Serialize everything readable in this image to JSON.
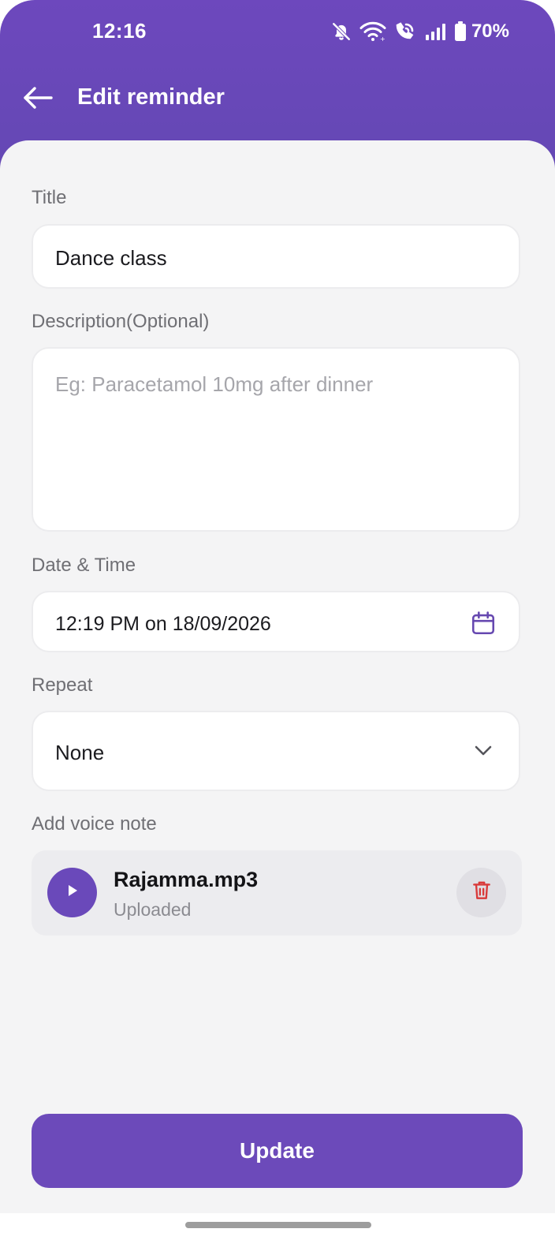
{
  "status_bar": {
    "time": "12:16",
    "battery": "70%",
    "icons": [
      "bell-off-icon",
      "wifi-icon",
      "wifi-calling-icon",
      "signal-icon",
      "battery-icon"
    ]
  },
  "header": {
    "title": "Edit reminder",
    "back_icon": "arrow-left-icon"
  },
  "form": {
    "title_label": "Title",
    "title_value": "Dance class",
    "description_label": "Description(Optional)",
    "description_placeholder": "Eg: Paracetamol 10mg after dinner",
    "datetime_label": "Date & Time",
    "datetime_value": "12:19 PM on 18/09/2026",
    "datetime_icon": "calendar-icon",
    "repeat_label": "Repeat",
    "repeat_value": "None",
    "repeat_icon": "chevron-down-icon",
    "voice_label": "Add voice note"
  },
  "voice_note": {
    "file_name": "Rajamma.mp3",
    "status": "Uploaded",
    "play_icon": "play-icon",
    "delete_icon": "trash-icon"
  },
  "actions": {
    "update_label": "Update"
  },
  "colors": {
    "primary": "#6c4aba",
    "background": "#f4f4f5",
    "delete_icon": "#d93a3a"
  }
}
